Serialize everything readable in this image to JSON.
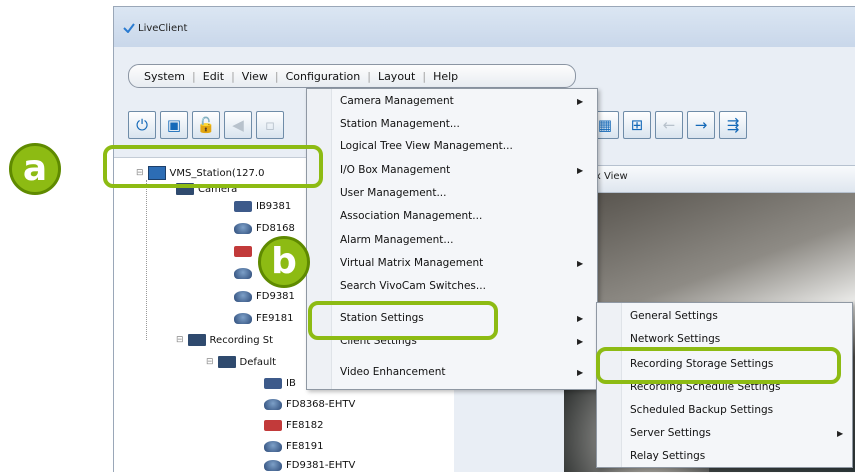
{
  "window": {
    "title": "LiveClient"
  },
  "menubar": {
    "items": [
      "System",
      "Edit",
      "View",
      "Configuration",
      "Layout",
      "Help"
    ]
  },
  "tree": {
    "station": "VMS_Station(127.0",
    "camera_folder": "Camera",
    "cameras": [
      "IB9381",
      "FD8168",
      "",
      "",
      "FD9381",
      "FE9181"
    ],
    "recording_folder": "Recording St",
    "default_folder": "Default",
    "recording_items": [
      "IB",
      "FD8368-EHTV",
      "FE8182",
      "FE8191",
      "FD9381-EHTV"
    ]
  },
  "tab": {
    "label": "rix View"
  },
  "config_menu": {
    "items": [
      "Camera Management",
      "Station Management...",
      "Logical Tree View Management...",
      "I/O Box Management",
      "User Management...",
      "Association Management...",
      "Alarm Management...",
      "Virtual Matrix Management",
      "Search VivoCam Switches...",
      "Station Settings",
      "Client Settings",
      "Video Enhancement"
    ]
  },
  "station_submenu": {
    "items": [
      "General Settings",
      "Network Settings",
      "Recording Storage Settings",
      "Recording Schedule Settings",
      "Scheduled Backup Settings",
      "Server Settings",
      "Relay Settings"
    ]
  },
  "annotations": {
    "a": "a",
    "b": "b"
  },
  "colors": {
    "callout": "#8dbb13",
    "toolbar_icon": "#1469b8"
  }
}
